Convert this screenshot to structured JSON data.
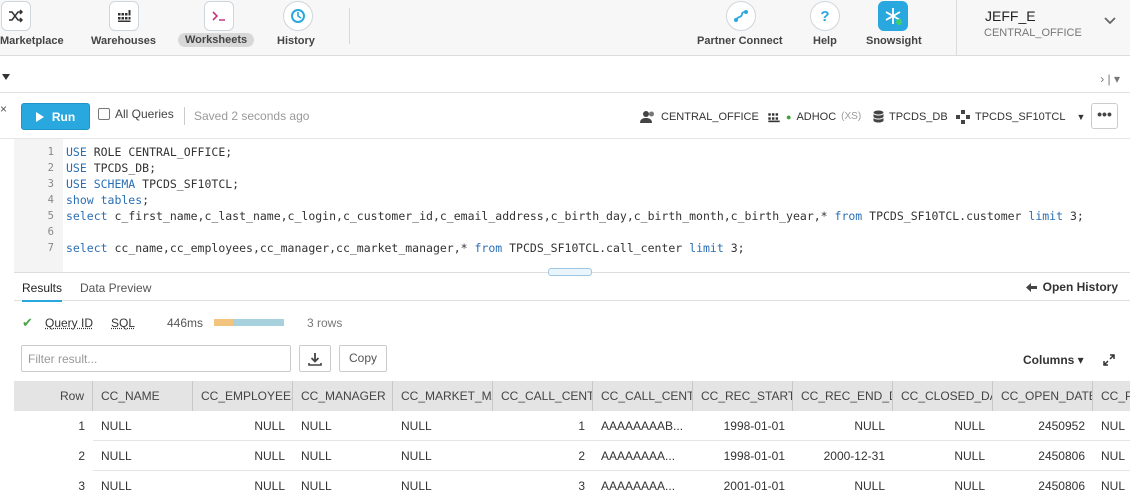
{
  "nav": {
    "items": [
      {
        "label": "Marketplace",
        "icon": "shuffle-icon"
      },
      {
        "label": "Warehouses",
        "icon": "warehouse-grid-icon"
      },
      {
        "label": "Worksheets",
        "icon": "terminal-icon"
      },
      {
        "label": "History",
        "icon": "history-icon"
      },
      {
        "label": "Partner Connect",
        "icon": "partner-link-icon"
      },
      {
        "label": "Help",
        "icon": "help-icon"
      },
      {
        "label": "Snowsight",
        "icon": "snowflake-icon"
      }
    ],
    "active": "Worksheets"
  },
  "user": {
    "name": "JEFF_E",
    "role": "CENTRAL_OFFICE"
  },
  "toolbar": {
    "run_label": "Run",
    "all_queries_label": "All Queries",
    "saved_text": "Saved 2 seconds ago",
    "context": {
      "role": "CENTRAL_OFFICE",
      "warehouse": "ADHOC",
      "warehouse_size": "(XS)",
      "database": "TPCDS_DB",
      "schema": "TPCDS_SF10TCL"
    },
    "more_label": "•••"
  },
  "editor": {
    "lines": [
      {
        "num": "1",
        "kw": "USE",
        "rest": " ROLE CENTRAL_OFFICE;"
      },
      {
        "num": "2",
        "kw": "USE",
        "rest": " TPCDS_DB;"
      },
      {
        "num": "3",
        "kw": "USE SCHEMA",
        "rest": " TPCDS_SF10TCL;"
      },
      {
        "num": "4",
        "kw": "show tables",
        "rest": ";"
      },
      {
        "num": "5",
        "kw": "select",
        "rest": " c_first_name,c_last_name,c_login,c_customer_id,c_email_address,c_birth_day,c_birth_month,c_birth_year,* ",
        "kw2": "from",
        "rest2": " TPCDS_SF10TCL.customer ",
        "kw3": "limit",
        "rest3": " 3;"
      },
      {
        "num": "6",
        "kw": "",
        "rest": ""
      },
      {
        "num": "7",
        "kw": "select",
        "rest": " cc_name,cc_employees,cc_manager,cc_market_manager,* ",
        "kw2": "from",
        "rest2": " TPCDS_SF10TCL.call_center ",
        "kw3": "limit",
        "rest3": " 3;"
      }
    ]
  },
  "results": {
    "tabs": [
      "Results",
      "Data Preview"
    ],
    "active_tab": "Results",
    "open_history": "Open History",
    "query_id_label": "Query ID",
    "sql_label": "SQL",
    "duration": "446ms",
    "progress_compile_fraction": 0.27,
    "row_count": "3 rows",
    "filter_placeholder": "Filter result...",
    "copy_label": "Copy",
    "columns_label": "Columns ▾"
  },
  "table": {
    "headers": [
      "Row",
      "CC_NAME",
      "CC_EMPLOYEES",
      "CC_MANAGER",
      "CC_MARKET_MA",
      "CC_CALL_CENT",
      "CC_CALL_CENT",
      "CC_REC_START_",
      "CC_REC_END_D",
      "CC_CLOSED_DA",
      "CC_OPEN_DATE",
      "CC_P"
    ],
    "rows": [
      [
        "1",
        "NULL",
        "NULL",
        "NULL",
        "NULL",
        "1",
        "AAAAAAAAB...",
        "1998-01-01",
        "NULL",
        "NULL",
        "2450952",
        "NUL"
      ],
      [
        "2",
        "NULL",
        "NULL",
        "NULL",
        "NULL",
        "2",
        "AAAAAAAA...",
        "1998-01-01",
        "2000-12-31",
        "NULL",
        "2450806",
        "NUL"
      ],
      [
        "3",
        "NULL",
        "NULL",
        "NULL",
        "NULL",
        "3",
        "AAAAAAAA...",
        "2001-01-01",
        "NULL",
        "NULL",
        "2450806",
        "NUL"
      ]
    ]
  }
}
